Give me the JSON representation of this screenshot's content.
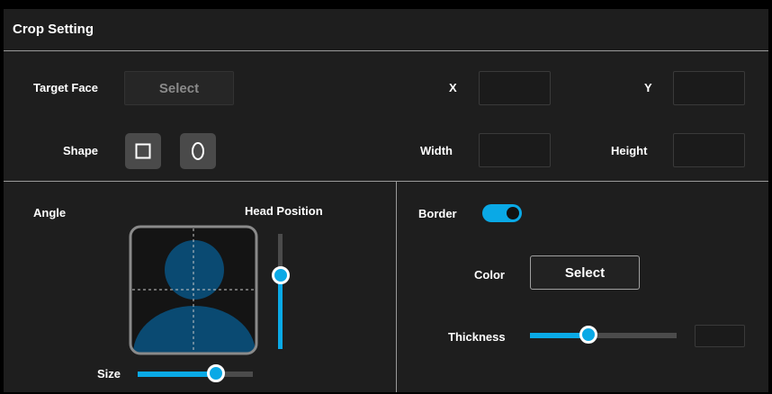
{
  "title": "Crop Setting",
  "target_face": {
    "label": "Target Face",
    "button": "Select",
    "enabled": false
  },
  "coords": {
    "x_label": "X",
    "y_label": "Y",
    "x_value": "",
    "y_value": ""
  },
  "shape": {
    "label": "Shape",
    "options": [
      "square-icon",
      "ellipse-icon"
    ]
  },
  "dimensions": {
    "width_label": "Width",
    "height_label": "Height",
    "width_value": "",
    "height_value": ""
  },
  "angle": {
    "label": "Angle"
  },
  "head_position": {
    "label": "Head Position",
    "level": 0.64
  },
  "size": {
    "label": "Size",
    "level": 0.68
  },
  "border": {
    "label": "Border",
    "enabled": true
  },
  "color": {
    "label": "Color",
    "button": "Select"
  },
  "thickness": {
    "label": "Thickness",
    "level": 0.4,
    "value": ""
  },
  "colors": {
    "accent": "#0aa9e6",
    "panel": "#1e1e1e",
    "portrait": "#0a4a72"
  }
}
